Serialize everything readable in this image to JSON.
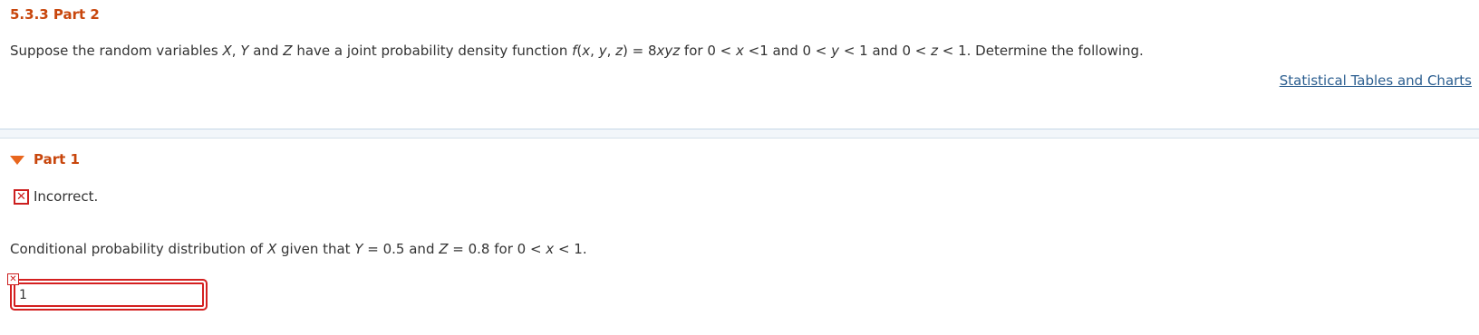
{
  "header": {
    "title": "5.3.3 Part 2"
  },
  "problem": {
    "t1": "Suppose the random variables ",
    "X": "X",
    "t2": ", ",
    "Y": "Y",
    "t3": " and ",
    "Z": "Z",
    "t4": " have a joint probability density function ",
    "f": "f",
    "t5": "(",
    "x1": "x",
    "t6": ", ",
    "y1": "y",
    "t7": ", ",
    "z1": "z",
    "t8": ") = 8",
    "xyz": "xyz",
    "t9": " for 0 < ",
    "x2": "x",
    "t10": " <1 and 0 < ",
    "y2": "y",
    "t11": " < 1 and 0 < ",
    "z2": "z",
    "t12": " < 1. Determine the following."
  },
  "link": {
    "label": "Statistical Tables and Charts"
  },
  "part": {
    "label": "Part 1"
  },
  "feedback": {
    "icon": "✕",
    "text": "Incorrect."
  },
  "question": {
    "q1": "Conditional probability distribution of ",
    "X": "X",
    "q2": " given that ",
    "Y": "Y",
    "q3": " = 0.5 and ",
    "Z": "Z",
    "q4": " = 0.8 for 0 < ",
    "x": "x",
    "q5": " < 1."
  },
  "answer": {
    "value": "1",
    "error_icon": "✕"
  },
  "colors": {
    "accent": "#c8460c",
    "error": "#d42020",
    "link": "#2a5d8f"
  }
}
